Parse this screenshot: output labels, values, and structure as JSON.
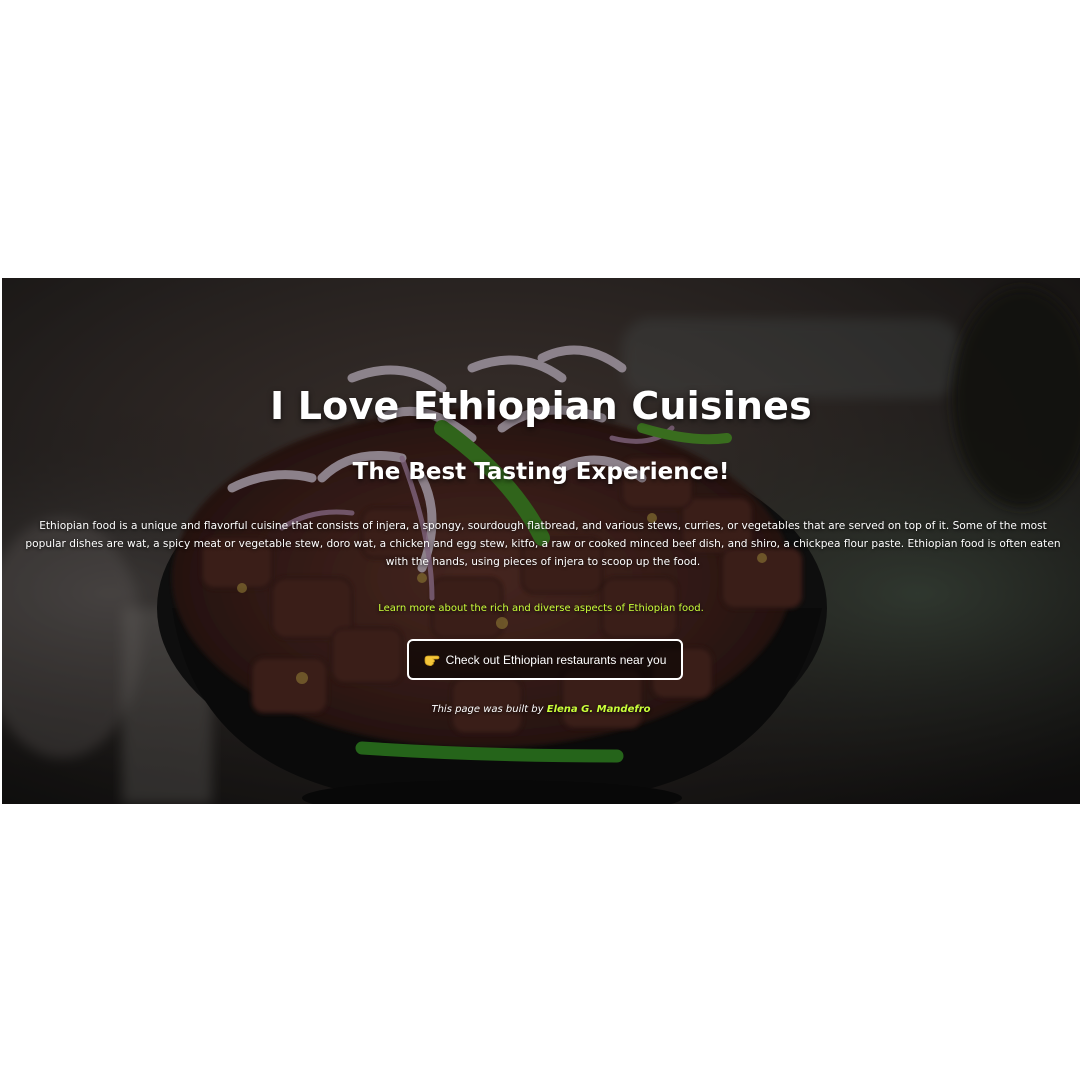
{
  "hero": {
    "title": "I Love Ethiopian Cuisines",
    "subtitle": "The Best Tasting Experience!",
    "description": "Ethiopian food is a unique and flavorful cuisine that consists of injera, a spongy, sourdough flatbread, and various stews, curries, or vegetables that are served on top of it. Some of the most popular dishes are wat, a spicy meat or vegetable stew, doro wat, a chicken and egg stew, kitfo, a raw or cooked minced beef dish, and shiro, a chickpea flour paste. Ethiopian food is often eaten with the hands, using pieces of injera to scoop up the food.",
    "learn_more_link": "Learn more about the rich and diverse aspects of Ethiopian food.",
    "cta_label": "Check out Ethiopian restaurants near you",
    "cta_icon": "pointing-hand-icon",
    "credit_prefix": "This page was built by",
    "credit_author": "Elena G. Mandefro"
  },
  "colors": {
    "link_accent": "#c9ff3a",
    "text": "#ffffff",
    "page_background": "#ffffff"
  }
}
